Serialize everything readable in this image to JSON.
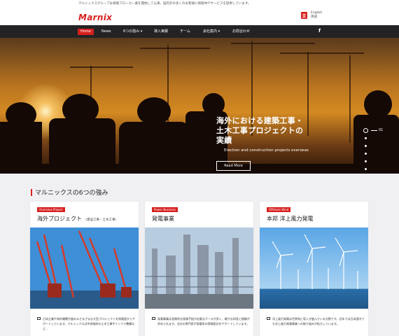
{
  "topbar": {
    "text": "マルニックスグループは保険ブローカー業を開始して以来、国内外の多くのお客様に保険仲介サービスを提供しています。"
  },
  "header": {
    "logo": "Marnix",
    "lang": {
      "line1": "English",
      "line2": "英語"
    }
  },
  "nav": {
    "items": [
      {
        "label": "Home",
        "active": true
      },
      {
        "label": "News"
      },
      {
        "label": "6つの強み ▾"
      },
      {
        "label": "導入実績"
      },
      {
        "label": "チーム"
      },
      {
        "label": "会社案内 ▾"
      },
      {
        "label": "お問合わせ"
      }
    ],
    "social": "f"
  },
  "hero": {
    "title_line1": "海外における建築工事・",
    "title_line2": "土木工事プロジェクトの",
    "title_line3": "実績",
    "subtitle": "Erection and construction projects overseas",
    "button": "Read More",
    "slide_number": "01"
  },
  "strengths": {
    "title": "マルニックスの6つの強み",
    "cards": [
      {
        "badge": "Overseas Project",
        "title": "海外プロジェクト",
        "title_note": "（建設工事・土木工事）",
        "text": "日本企業や海外機関が進めるさまざまな大型プロジェクトを保険面からサポートしています。マルニックスは中央政府の土木工事やインフラ整備など..."
      },
      {
        "badge": "Power Business",
        "title": "発電事業",
        "title_note": "",
        "text": "発電事業は長期的な保険手配が必要なケースが多く、確かな知見と経験が求められます。当社の専門家が発電所の保険設計をサポートしています。"
      },
      {
        "badge": "Offshore Wind",
        "title": "本邦 洋上風力発電",
        "title_note": "",
        "text": "洋上風力発電は世界的に導入が進んでいる分野です。近年では日本国内でも洋上風力発電事業への取り組みが拡大しています。"
      }
    ]
  },
  "colors": {
    "accent": "#d7201e",
    "nav_bg": "#232325",
    "page_bg": "#f0f0f3"
  }
}
